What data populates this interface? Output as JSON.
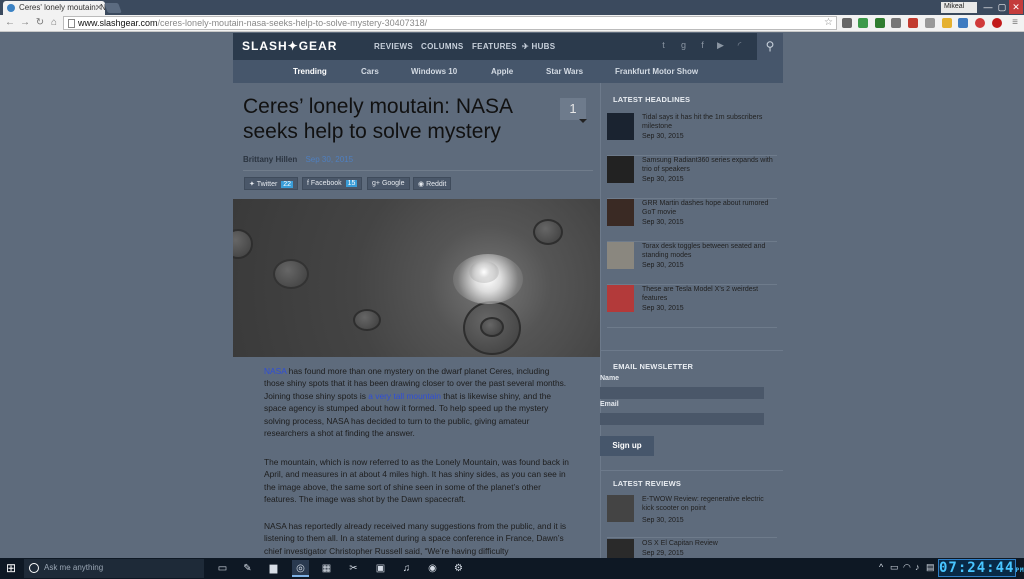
{
  "browser": {
    "tab_title": "Ceres' lonely moutain: NA",
    "user": "Mikeal",
    "url_host": "www.slashgear.com",
    "url_path": "/ceres-lonely-moutain-nasa-seeks-help-to-solve-mystery-30407318/",
    "win_min": "—",
    "win_max": "▢",
    "win_close": "✕"
  },
  "site": {
    "logo": "SLASH✦GEAR",
    "nav": [
      "REVIEWS",
      "COLUMNS",
      "FEATURES",
      "✈ HUBS"
    ],
    "social_icons": [
      "twitter-icon",
      "google-plus-icon",
      "facebook-icon",
      "youtube-icon",
      "rss-icon"
    ],
    "subnav": [
      "Trending",
      "Cars",
      "Windows 10",
      "Apple",
      "Star Wars",
      "Frankfurt Motor Show"
    ]
  },
  "article": {
    "title": "Ceres’ lonely moutain: NASA seeks help to solve mystery",
    "comment_count": "1",
    "author": "Brittany Hillen",
    "date": "Sep 30, 2015",
    "share": {
      "twitter": "Twitter",
      "twitter_count": "22",
      "facebook": "Facebook",
      "facebook_count": "15",
      "google": "Google",
      "reddit": "Reddit"
    },
    "p1_link1": "NASA",
    "p1_a": " has found more than one mystery on the dwarf planet Ceres, including those shiny spots that it has been drawing closer to over the past several months. Joining those shiny spots is ",
    "p1_link2": "a very tall mountain",
    "p1_b": " that is likewise shiny, and the space agency is stumped about how it formed. To help speed up the mystery solving process, NASA has decided to turn to the public, giving amateur researchers a shot at finding the answer.",
    "p2": "The mountain, which is now referred to as the Lonely Mountain, was found back in April, and measures in at about 4 miles high. It has shiny sides, as you can see in the image above, the same sort of shine seen in some of the planet’s other features. The image was shot by the Dawn spacecraft.",
    "p3": "NASA has reportedly already received many suggestions from the public, and it is listening to them all. In a statement during a space conference in France, Dawn’s chief investigator Christopher Russell said, “We’re having difficulty"
  },
  "sidebar": {
    "latest_headlines_title": "LATEST HEADLINES",
    "headlines": [
      {
        "title": "Tidal says it has hit the 1m subscribers milestone",
        "date": "Sep 30, 2015"
      },
      {
        "title": "Samsung Radiant360 series expands with trio of speakers",
        "date": "Sep 30, 2015"
      },
      {
        "title": "GRR Martin dashes hope about rumored GoT movie",
        "date": "Sep 30, 2015"
      },
      {
        "title": "Torax desk toggles between seated and standing modes",
        "date": "Sep 30, 2015"
      },
      {
        "title": "These are Tesla Model X’s 2 weirdest features",
        "date": "Sep 30, 2015"
      }
    ],
    "newsletter_title": "EMAIL NEWSLETTER",
    "name_label": "Name",
    "email_label": "Email",
    "signup": "Sign up",
    "latest_reviews_title": "LATEST REVIEWS",
    "reviews": [
      {
        "title": "E-TWOW Review: regenerative electric kick scooter on point",
        "date": "Sep 30, 2015"
      },
      {
        "title": "OS X El Capitan Review",
        "date": "Sep 29, 2015"
      }
    ]
  },
  "taskbar": {
    "search_placeholder": "Ask me anything",
    "clock": "07:24:44",
    "clock_ampm": "PM"
  }
}
